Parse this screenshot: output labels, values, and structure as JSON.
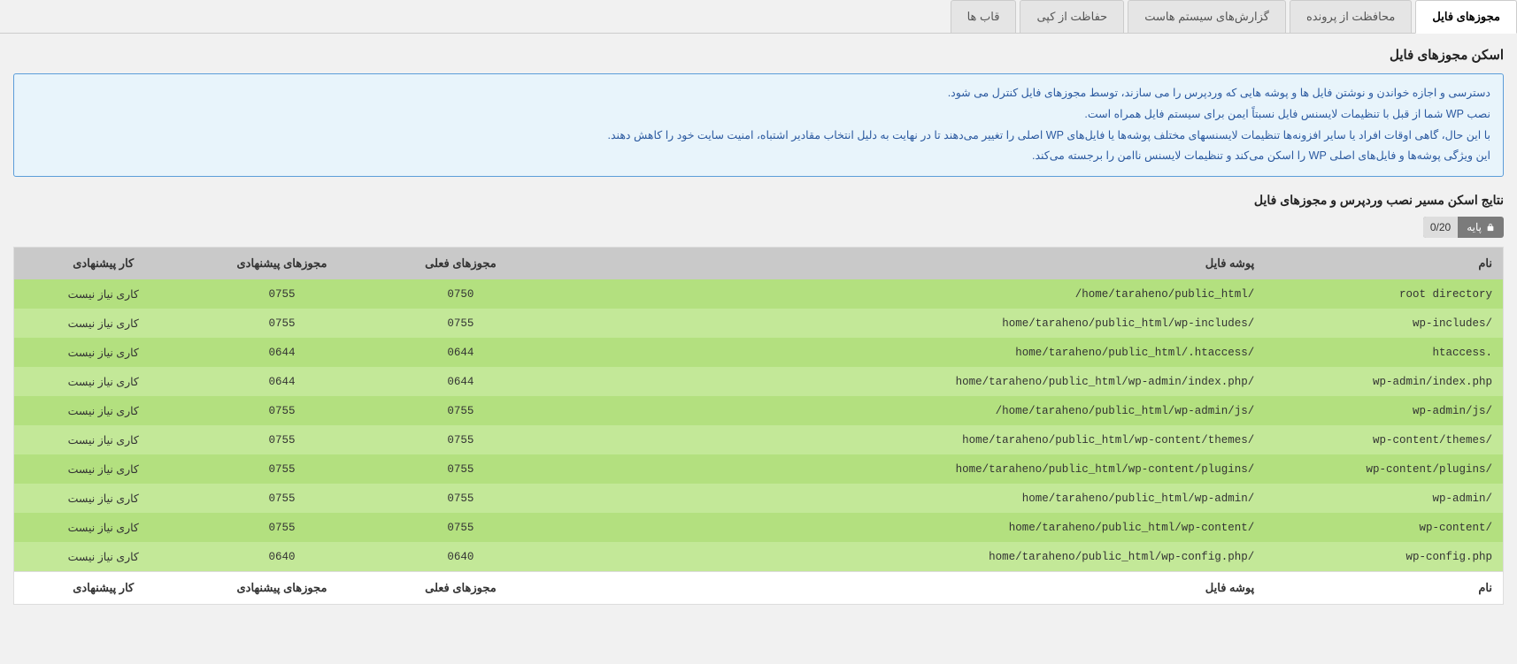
{
  "tabs": [
    {
      "label": "مجوزهای فایل",
      "active": true
    },
    {
      "label": "محافظت از پرونده",
      "active": false
    },
    {
      "label": "گزارش‌های سیستم هاست",
      "active": false
    },
    {
      "label": "حفاظت از کپی",
      "active": false
    },
    {
      "label": "قاب ها",
      "active": false
    }
  ],
  "section_title": "اسکن مجوزهای فایل",
  "info_lines": [
    "دسترسی و اجازه خواندن و نوشتن فایل ها و پوشه هایی که وردپرس را می سازند، توسط مجوزهای فایل کنترل می شود.",
    "نصب WP شما از قبل با تنظیمات لایسنس فایل نسبتاً ایمن برای سیستم فایل همراه است.",
    "با این حال، گاهی اوقات افراد یا سایر افزونه‌ها تنظیمات لایسنسهای مختلف پوشه‌ها یا فایل‌های WP اصلی را تغییر می‌دهند تا در نهایت به دلیل انتخاب مقادیر اشتباه، امنیت سایت خود را کاهش دهند.",
    "این ویژگی پوشه‌ها و فایل‌های اصلی WP را اسکن می‌کند و تنظیمات لایسنس ناامن را برجسته می‌کند."
  ],
  "results_title": "نتایج اسکن مسیر نصب وردپرس و مجوزهای فایل",
  "badge": {
    "label": "پایه",
    "count": "0/20"
  },
  "columns": {
    "name": "نام",
    "path": "پوشه فایل",
    "current": "مجوزهای فعلی",
    "recommended": "مجوزهای پیشنهادی",
    "action": "کار پیشنهادی"
  },
  "rows": [
    {
      "name": "root directory",
      "path": "/home/taraheno/public_html/",
      "current": "0750",
      "rec": "0755",
      "action": "کاری نیاز نیست"
    },
    {
      "name": "wp-includes/",
      "path": "home/taraheno/public_html/wp-includes/",
      "current": "0755",
      "rec": "0755",
      "action": "کاری نیاز نیست"
    },
    {
      "name": "htaccess.",
      "path": "home/taraheno/public_html/.htaccess/",
      "current": "0644",
      "rec": "0644",
      "action": "کاری نیاز نیست"
    },
    {
      "name": "wp-admin/index.php",
      "path": "home/taraheno/public_html/wp-admin/index.php/",
      "current": "0644",
      "rec": "0644",
      "action": "کاری نیاز نیست"
    },
    {
      "name": "wp-admin/js/",
      "path": "/home/taraheno/public_html/wp-admin/js/",
      "current": "0755",
      "rec": "0755",
      "action": "کاری نیاز نیست"
    },
    {
      "name": "wp-content/themes/",
      "path": "home/taraheno/public_html/wp-content/themes/",
      "current": "0755",
      "rec": "0755",
      "action": "کاری نیاز نیست"
    },
    {
      "name": "wp-content/plugins/",
      "path": "home/taraheno/public_html/wp-content/plugins/",
      "current": "0755",
      "rec": "0755",
      "action": "کاری نیاز نیست"
    },
    {
      "name": "wp-admin/",
      "path": "home/taraheno/public_html/wp-admin/",
      "current": "0755",
      "rec": "0755",
      "action": "کاری نیاز نیست"
    },
    {
      "name": "wp-content/",
      "path": "home/taraheno/public_html/wp-content/",
      "current": "0755",
      "rec": "0755",
      "action": "کاری نیاز نیست"
    },
    {
      "name": "wp-config.php",
      "path": "home/taraheno/public_html/wp-config.php/",
      "current": "0640",
      "rec": "0640",
      "action": "کاری نیاز نیست"
    }
  ]
}
